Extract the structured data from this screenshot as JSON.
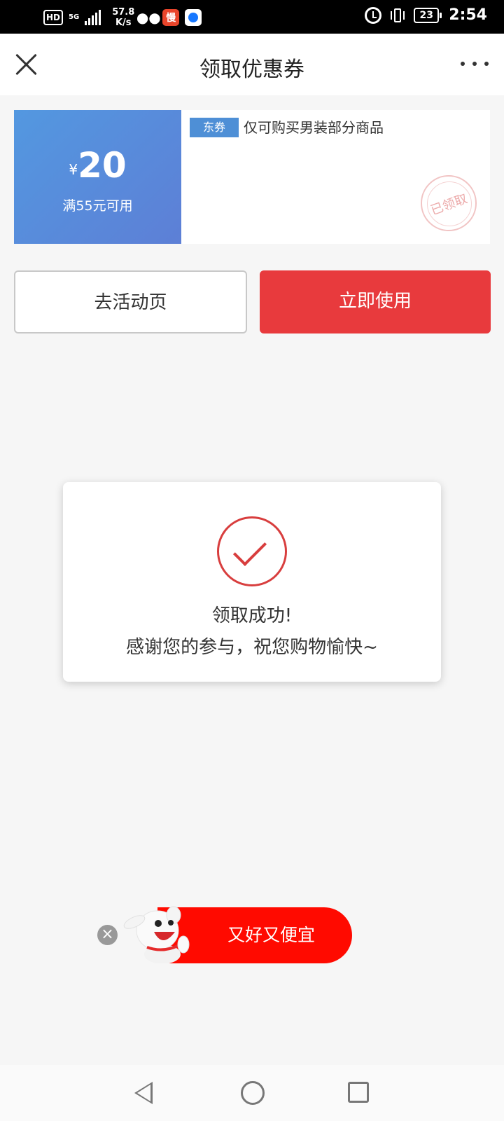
{
  "status_bar": {
    "hd": "HD",
    "network": "5G",
    "speed_value": "57.8",
    "speed_unit": "K/s",
    "battery": "23",
    "time": "2:54"
  },
  "header": {
    "title": "领取优惠券"
  },
  "coupon": {
    "currency": "¥",
    "amount": "20",
    "condition": "满55元可用",
    "tag": "东券",
    "description": "仅可购买男装部分商品",
    "stamp": "已领取"
  },
  "buttons": {
    "activity": "去活动页",
    "use_now": "立即使用"
  },
  "dialog": {
    "title": "领取成功!",
    "message": "感谢您的参与，祝您购物愉快~"
  },
  "banner": {
    "text": "又好又便宜",
    "close": "×"
  },
  "colors": {
    "coupon_blue": "#5398e0",
    "primary_red": "#e83a3d",
    "banner_red": "#ff0a00",
    "check_red": "#d83e3e"
  }
}
